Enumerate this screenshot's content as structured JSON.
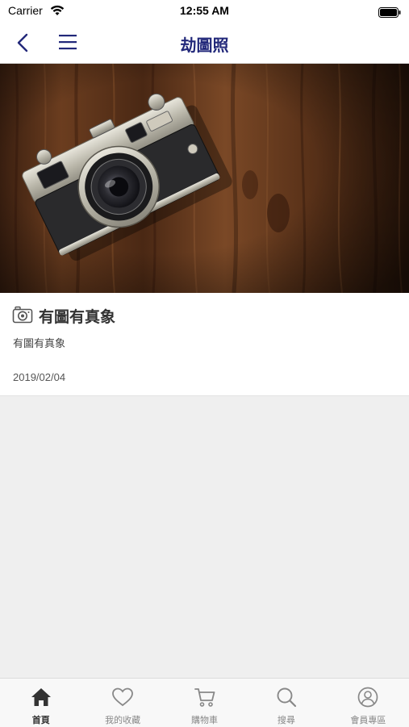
{
  "status_bar": {
    "carrier": "Carrier",
    "time": "12:55 AM"
  },
  "nav": {
    "title": "劫圖照",
    "back_icon": "chevron-left-icon",
    "menu_icon": "hamburger-menu-icon"
  },
  "article": {
    "title": "有圖有真象",
    "summary": "有圖有真象",
    "date": "2019/02/04",
    "icon": "camera-icon"
  },
  "tabs": [
    {
      "label": "首頁",
      "icon": "home-icon",
      "active": true
    },
    {
      "label": "我的收藏",
      "icon": "heart-icon",
      "active": false
    },
    {
      "label": "購物車",
      "icon": "cart-icon",
      "active": false
    },
    {
      "label": "搜尋",
      "icon": "search-icon",
      "active": false
    },
    {
      "label": "會員專區",
      "icon": "user-icon",
      "active": false
    }
  ],
  "colors": {
    "accent": "#22287a",
    "background": "#efefef",
    "tab_active": "#333333",
    "tab_inactive": "#888888"
  }
}
